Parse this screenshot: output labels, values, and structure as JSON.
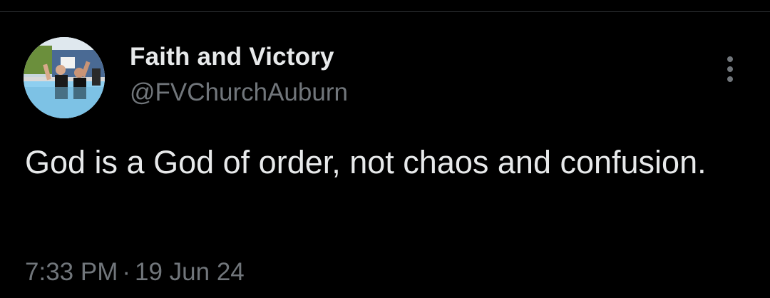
{
  "tweet": {
    "author": {
      "display_name": "Faith and Victory",
      "handle": "@FVChurchAuburn",
      "avatar_icon": "church-baptism-photo"
    },
    "text": "God is a God of order, not chaos and confusion.",
    "time": "7:33 PM",
    "separator": "·",
    "date": "19 Jun 24",
    "more_icon": "more-vertical-icon"
  },
  "colors": {
    "background": "#000000",
    "primary_text": "#e7e9ea",
    "secondary_text": "#71767b",
    "divider": "#2f3336"
  }
}
